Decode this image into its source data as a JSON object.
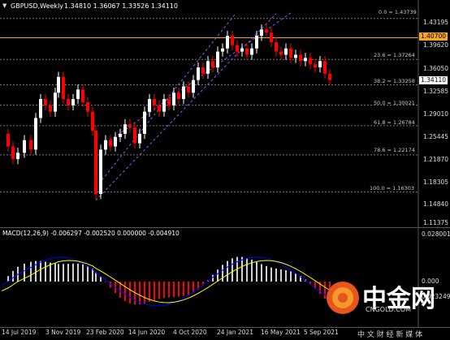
{
  "header": {
    "collapse_icon": "triangle-down-icon",
    "symbol": "GBPUSD,Weekly",
    "ohlc": "1.34810 1.36067 1.33526 1.34110"
  },
  "price_axis": {
    "labels": [
      "1.43195",
      "1.39620",
      "1.36050",
      "1.32585",
      "1.29010",
      "1.25445",
      "1.21870",
      "1.18305",
      "1.14840",
      "1.11375"
    ],
    "highlight": {
      "label": "1.40700",
      "color": "#f5a623"
    },
    "current": {
      "label": "1.34110"
    }
  },
  "fibonacci": {
    "levels": [
      "0.0 = 1.43739",
      "23.6 = 1.37264",
      "38.2 = 1.33258",
      "50.0 = 1.30021",
      "61.8 = 1.26784",
      "78.6 = 1.22174",
      "100.0 = 1.16303"
    ]
  },
  "macd": {
    "title": "MACD(12,26,9) -0.006297 -0.002520 0.000000 -0.004910",
    "axis": [
      "0.028001",
      "0.000",
      "-0.023249"
    ]
  },
  "time_axis": {
    "labels": [
      "14 Jul 2019",
      "3 Nov 2019",
      "23 Feb 2020",
      "14 Jun 2020",
      "4 Oct 2020",
      "24 Jan 2021",
      "16 May 2021",
      "5 Sep 2021"
    ]
  },
  "watermark": {
    "brand": "中金网",
    "site": "CNGOLD.COM",
    "slogan": "中 文 财 经 新 媒 体"
  },
  "colors": {
    "bull": "#ffffff",
    "bear": "#ff0000",
    "channel": "#8a5cf6",
    "macd_signal": "#ffff00",
    "macd_line": "#0000ff",
    "orange": "#f5a623"
  }
}
